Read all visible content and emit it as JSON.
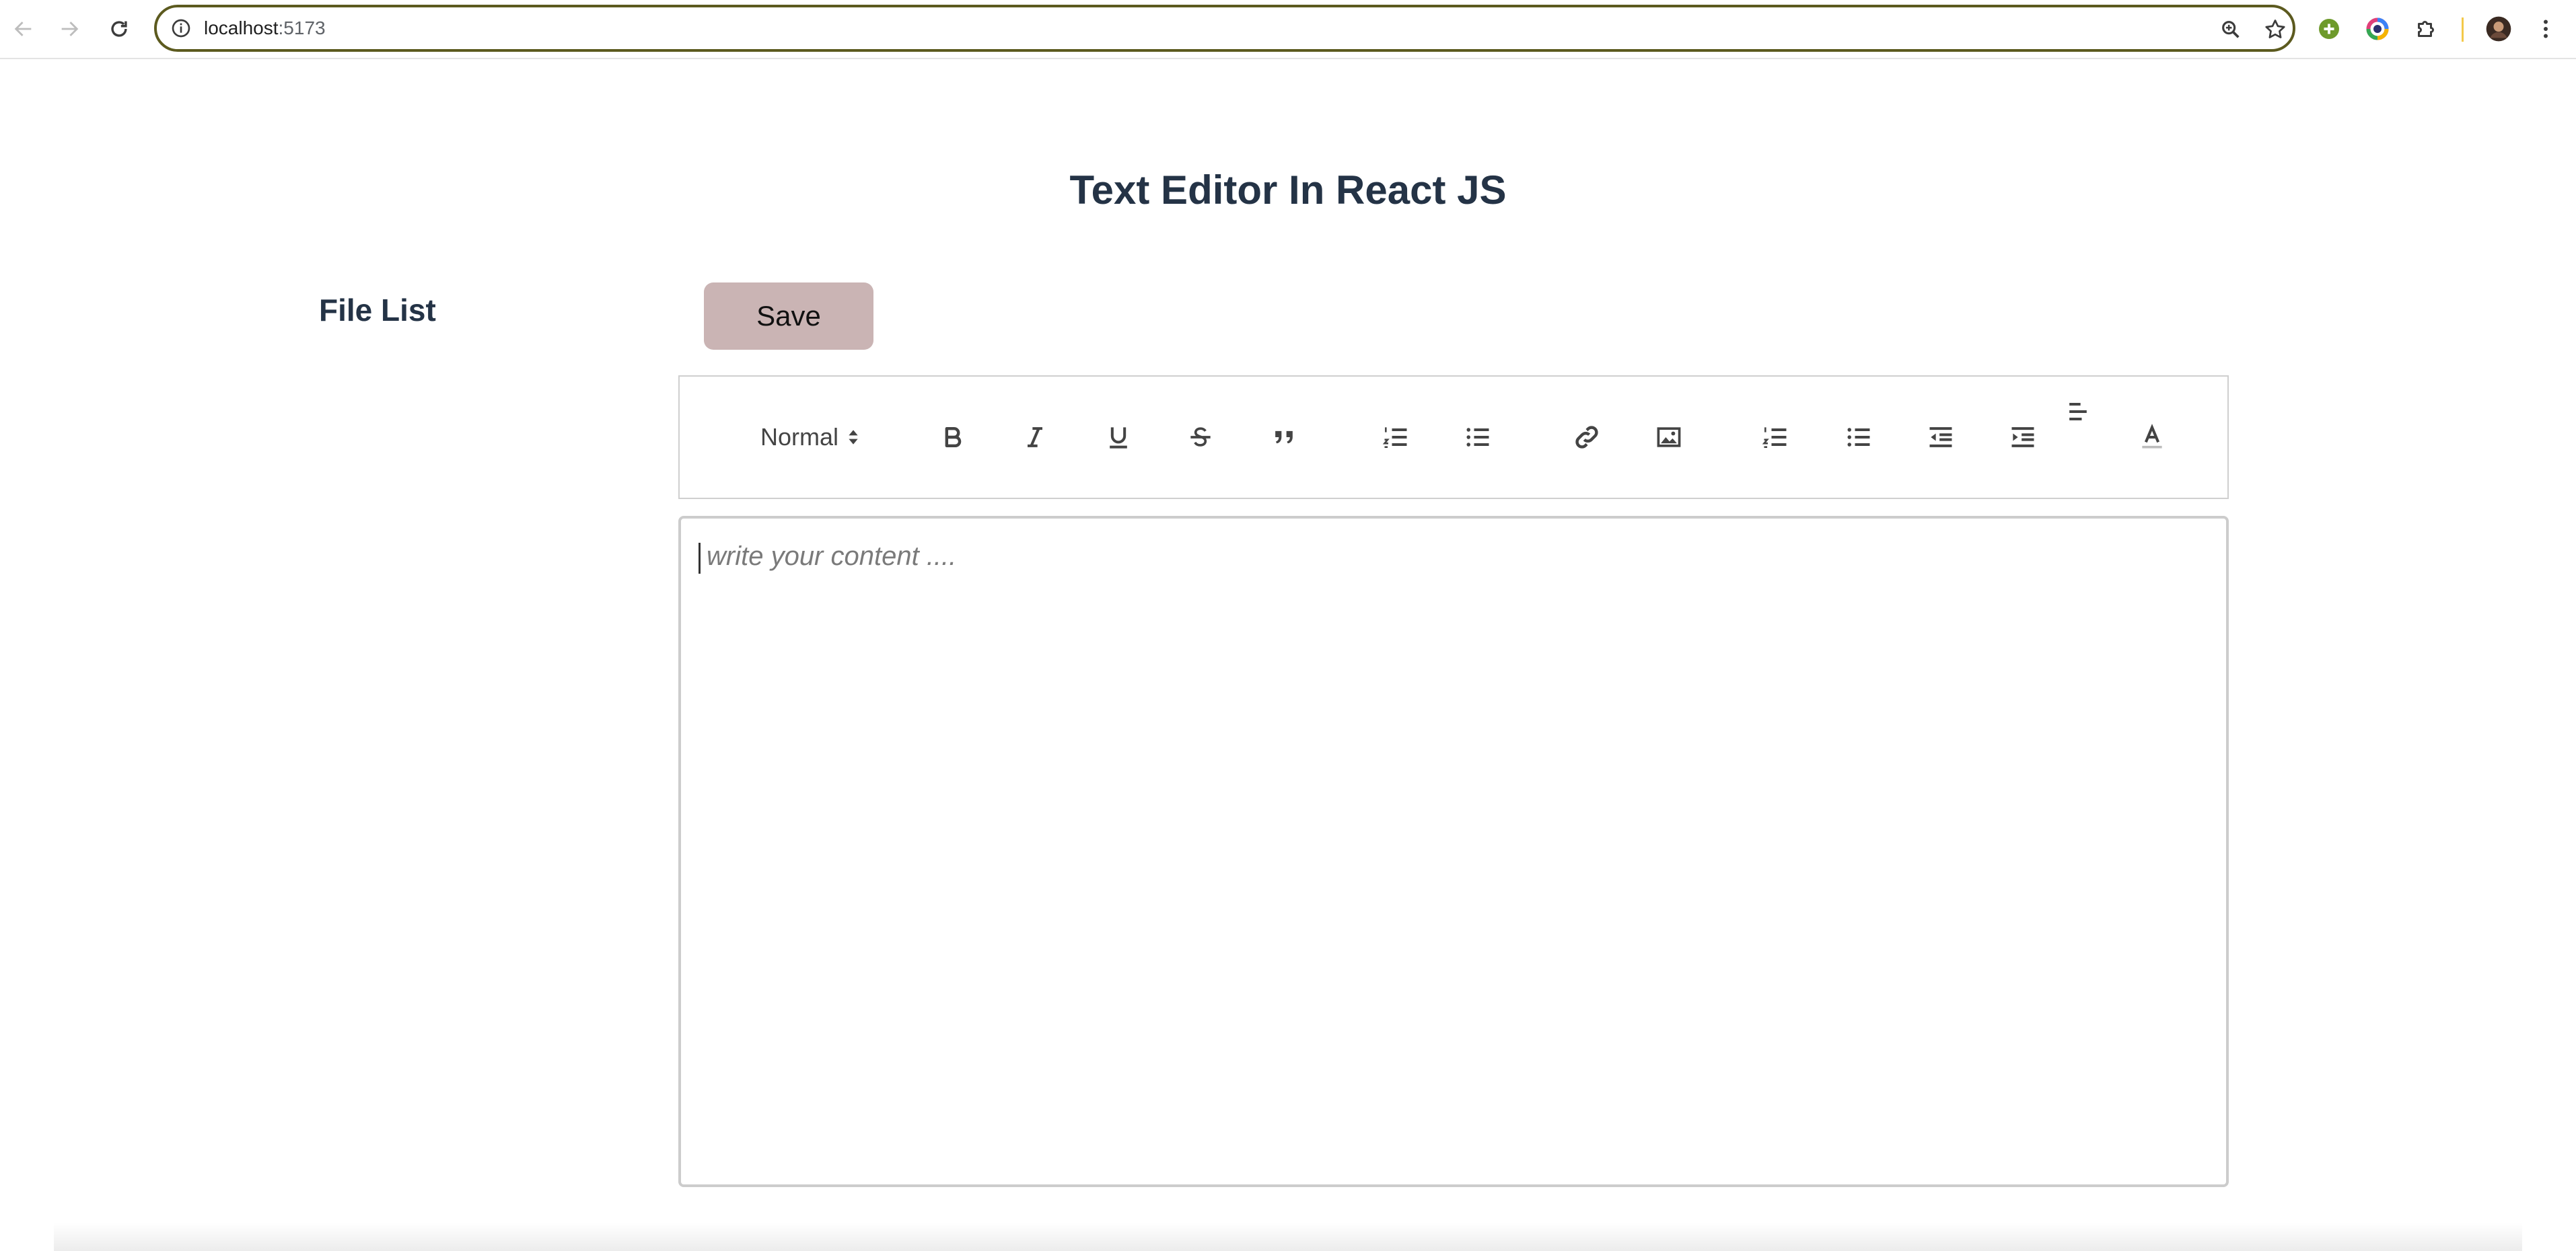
{
  "browser": {
    "url_host": "localhost",
    "url_port": ":5173",
    "colors": {
      "omnibox_border": "#5c5a1f"
    },
    "icons": {
      "back": "arrow-left-icon",
      "forward": "arrow-right-icon",
      "reload": "reload-icon",
      "site_info": "info-icon",
      "zoom": "zoom-icon",
      "bookmark": "star-icon",
      "ext_green": "plus-circle-icon",
      "ext_color": "color-ring-icon",
      "ext_puzzle": "puzzle-icon",
      "profile": "avatar-icon",
      "menu": "kebab-menu-icon"
    }
  },
  "page": {
    "title": "Text Editor In React JS",
    "sidebar_title": "File List",
    "save_label": "Save",
    "colors": {
      "heading": "#243346",
      "save_button": "#cab4b4"
    }
  },
  "toolbar": {
    "header_value": "Normal",
    "buttons": [
      "bold-icon",
      "italic-icon",
      "underline-icon",
      "strikethrough-icon",
      "blockquote-icon",
      "ordered-list-icon",
      "bullet-list-icon",
      "link-icon",
      "image-icon",
      "ordered-list-icon",
      "bullet-list-icon",
      "outdent-icon",
      "indent-icon",
      "align-icon",
      "text-color-icon"
    ]
  },
  "editor": {
    "placeholder": "write your content ...."
  }
}
